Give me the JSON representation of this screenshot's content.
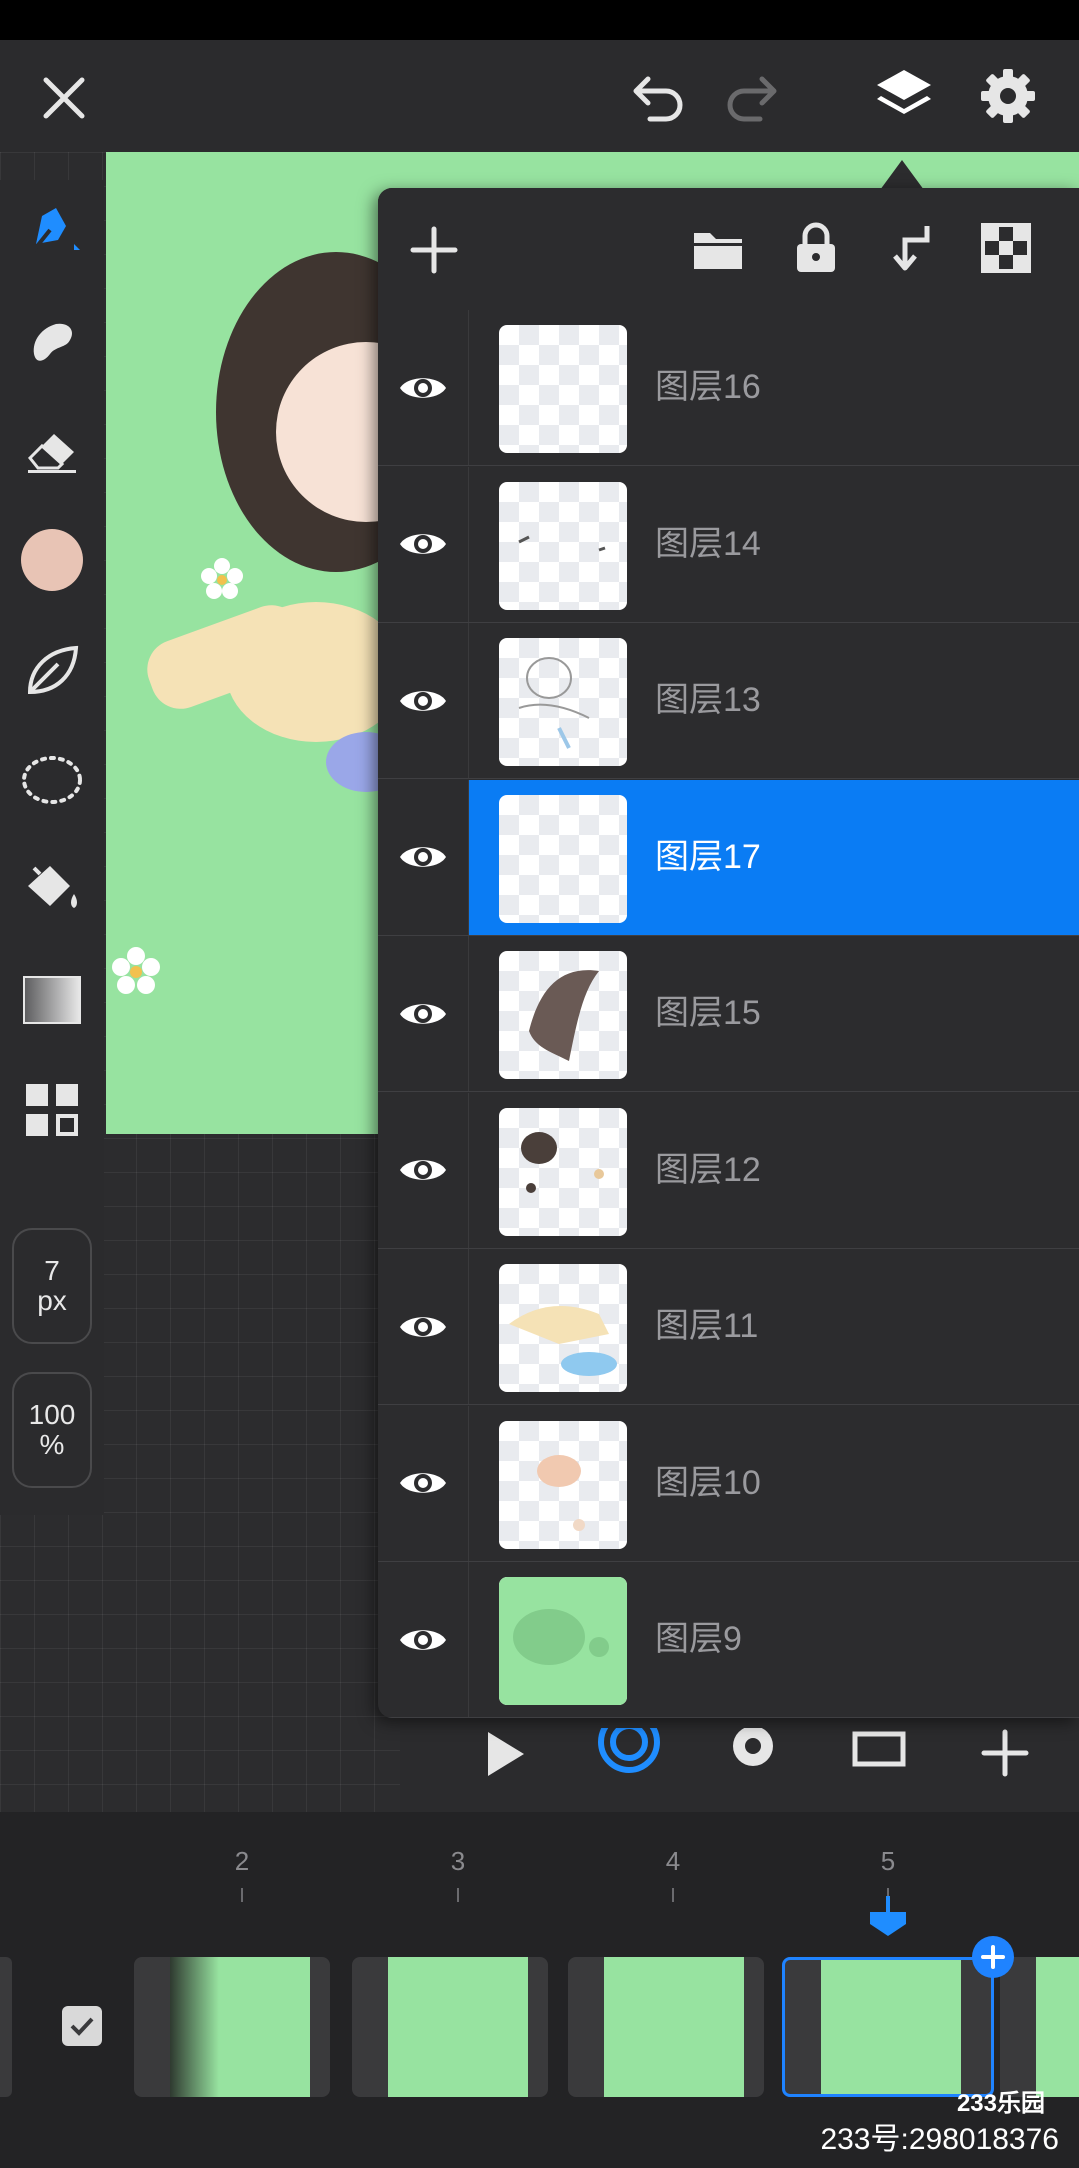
{
  "app": {
    "accent_color": "#0a7cf4",
    "toolbar_bg": "#2b2b2d",
    "canvas_color": "#97e3a0"
  },
  "topbar": {
    "close_icon": "close-icon",
    "undo_icon": "undo-icon",
    "redo_icon": "redo-icon",
    "layers_icon": "layers-icon",
    "settings_icon": "gear-icon"
  },
  "tools": {
    "items": [
      "pen",
      "smudge",
      "eraser",
      "color",
      "shape",
      "lasso",
      "fill",
      "gradient",
      "panels"
    ],
    "color_swatch": "#e8c4b5",
    "brush_size_value": "7",
    "brush_size_unit": "px",
    "opacity_value": "100",
    "opacity_unit": "%"
  },
  "layers_panel": {
    "toolbar_icons": [
      "add-icon",
      "folder-icon",
      "lock-icon",
      "merge-down-icon",
      "transparency-icon"
    ],
    "selected_index": 3,
    "layers": [
      {
        "name": "图层16",
        "visible": true
      },
      {
        "name": "图层14",
        "visible": true
      },
      {
        "name": "图层13",
        "visible": true
      },
      {
        "name": "图层17",
        "visible": true
      },
      {
        "name": "图层15",
        "visible": true
      },
      {
        "name": "图层12",
        "visible": true
      },
      {
        "name": "图层11",
        "visible": true
      },
      {
        "name": "图层10",
        "visible": true
      },
      {
        "name": "图层9",
        "visible": true
      }
    ]
  },
  "timeline": {
    "frame_numbers": [
      "2",
      "3",
      "4",
      "5"
    ],
    "current_frame": "5",
    "controls": [
      "play-icon",
      "onion-skin-icon",
      "settings-icon",
      "frame-icon",
      "add-icon"
    ]
  },
  "watermark": {
    "logo": "233乐园",
    "id_text": "233号:298018376"
  }
}
